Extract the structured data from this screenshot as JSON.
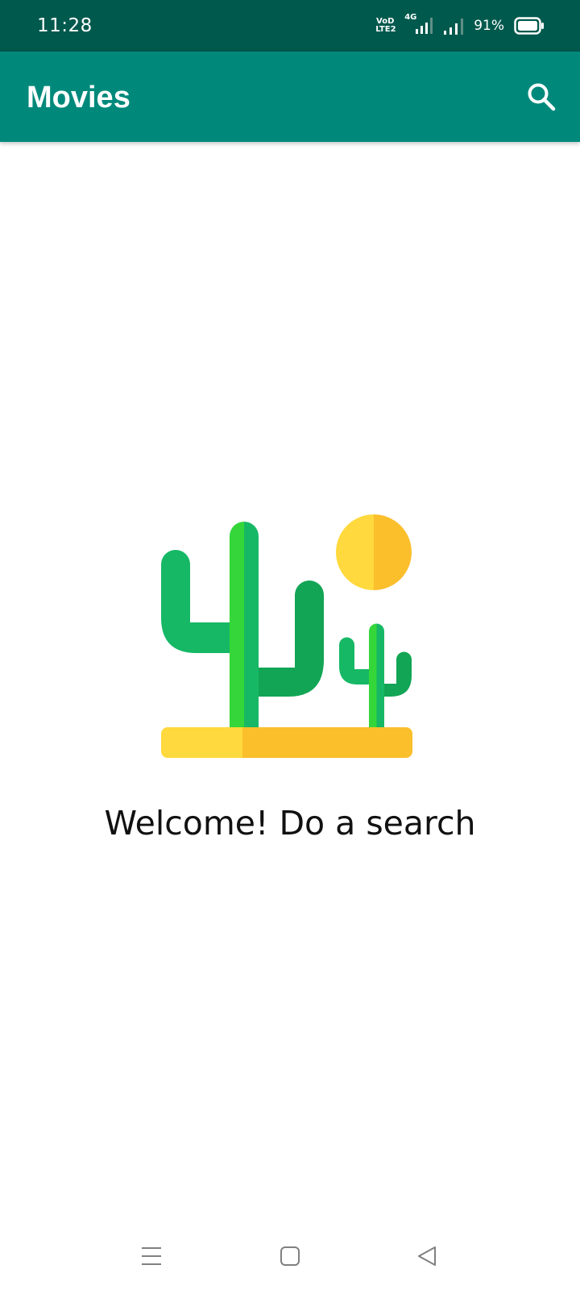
{
  "status_bar": {
    "time": "11:28",
    "volte_top": "VoD",
    "volte_bottom": "LTE2",
    "network": "4G",
    "battery": "91%"
  },
  "app_bar": {
    "title": "Movies",
    "search_icon": "search-icon"
  },
  "empty_state": {
    "illustration": "desert-cactus-sun-illustration",
    "message": "Welcome! Do a search"
  },
  "nav_bar": {
    "items": [
      "menu-icon",
      "home-icon",
      "back-icon"
    ]
  },
  "colors": {
    "status_bar": "#00594D",
    "app_bar": "#00897B",
    "cactus_light": "#16B865",
    "cactus_bright": "#34D63A",
    "cactus_dark": "#12A555",
    "sun_light": "#FFD93D",
    "sun_dark": "#FBBF2C"
  }
}
